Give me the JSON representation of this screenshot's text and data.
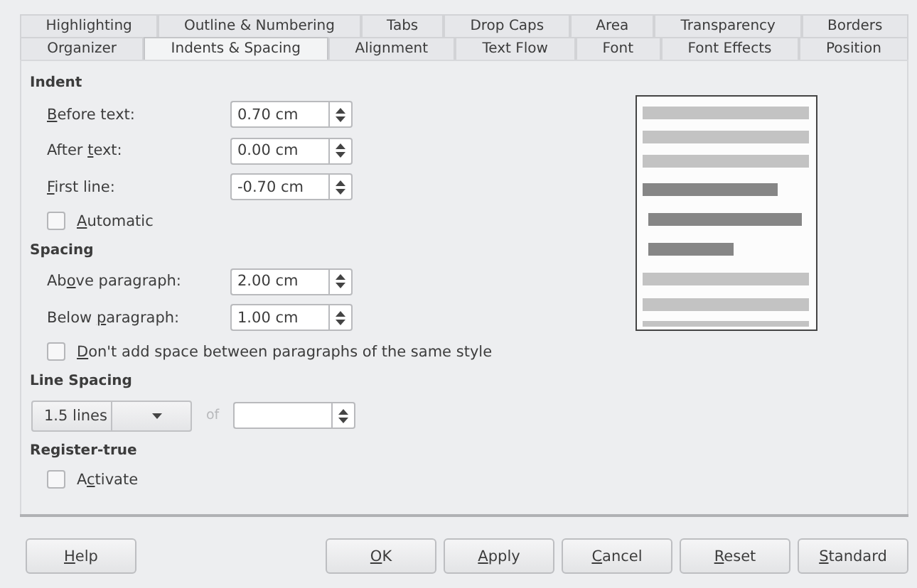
{
  "tab_rows": [
    [
      {
        "label": "Highlighting",
        "selected": false
      },
      {
        "label": "Outline & Numbering",
        "selected": false
      },
      {
        "label": "Tabs",
        "selected": false
      },
      {
        "label": "Drop Caps",
        "selected": false
      },
      {
        "label": "Area",
        "selected": false
      },
      {
        "label": "Transparency",
        "selected": false
      },
      {
        "label": "Borders",
        "selected": false
      }
    ],
    [
      {
        "label": "Organizer",
        "selected": false
      },
      {
        "label": "Indents & Spacing",
        "selected": true
      },
      {
        "label": "Alignment",
        "selected": false
      },
      {
        "label": "Text Flow",
        "selected": false
      },
      {
        "label": "Font",
        "selected": false
      },
      {
        "label": "Font Effects",
        "selected": false
      },
      {
        "label": "Position",
        "selected": false
      }
    ]
  ],
  "sections": [
    {
      "title": "Indent",
      "rows": [
        {
          "kind": "spin",
          "label": {
            "key": "B",
            "post": "efore text:"
          },
          "value": "0.70 cm"
        },
        {
          "kind": "spin",
          "label": {
            "pre": "After ",
            "key": "t",
            "post": "ext:"
          },
          "value": "0.00 cm"
        },
        {
          "kind": "spin",
          "label": {
            "key": "F",
            "post": "irst line:"
          },
          "value": "-0.70 cm"
        },
        {
          "kind": "check",
          "label": {
            "key": "A",
            "post": "utomatic"
          },
          "checked": false
        }
      ]
    },
    {
      "title": "Spacing",
      "rows": [
        {
          "kind": "spin",
          "label": {
            "pre": "Ab",
            "key": "o",
            "post": "ve paragraph:"
          },
          "value": "2.00 cm"
        },
        {
          "kind": "spin",
          "label": {
            "pre": "Below ",
            "key": "p",
            "post": "aragraph:"
          },
          "value": "1.00 cm"
        },
        {
          "kind": "check",
          "label": {
            "key": "D",
            "post": "on't add space between paragraphs of the same style"
          },
          "checked": false
        }
      ]
    },
    {
      "title": "Line Spacing",
      "rows": [
        {
          "kind": "select",
          "value": "1.5 lines",
          "of_label": "of",
          "of_disabled": true
        }
      ]
    },
    {
      "title": "Register-true",
      "rows": [
        {
          "kind": "check",
          "label": {
            "pre": "A",
            "key": "c",
            "post": "tivate"
          },
          "checked": false
        }
      ]
    }
  ],
  "help_button": {
    "label": {
      "key": "H",
      "post": "elp"
    }
  },
  "buttons": [
    {
      "label": {
        "key": "O",
        "post": "K"
      }
    },
    {
      "label": {
        "key": "A",
        "post": "pply"
      }
    },
    {
      "label": {
        "key": "C",
        "post": "ancel"
      }
    },
    {
      "label": {
        "key": "R",
        "post": "eset"
      }
    },
    {
      "label": {
        "key": "S",
        "post": "tandard"
      }
    }
  ]
}
